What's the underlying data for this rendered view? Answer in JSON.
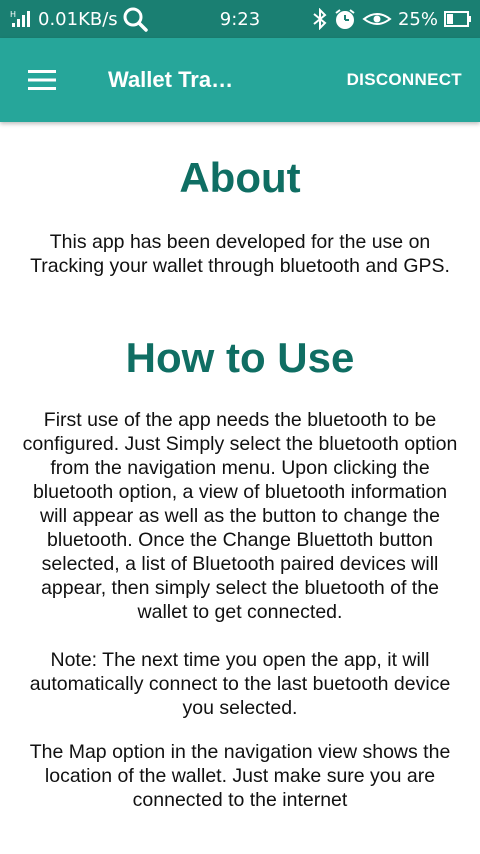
{
  "status_bar": {
    "network_speed": "0.01KB/s",
    "time": "9:23",
    "battery": "25%",
    "icons": [
      "signal-icon",
      "search-icon",
      "bluetooth-icon",
      "alarm-icon",
      "eye-icon",
      "battery-icon"
    ]
  },
  "app_bar": {
    "menu_icon": "hamburger-menu-icon",
    "title": "Wallet Tra…",
    "action": "DISCONNECT"
  },
  "about": {
    "title": "About",
    "text": "This app has been developed for the use on Tracking your wallet through bluetooth and GPS."
  },
  "how_to_use": {
    "title": "How to Use",
    "text": "First use of the app needs the bluetooth to be configured. Just Simply select the bluetooth option from the navigation menu. Upon clicking the bluetooth option, a view of bluetooth information will appear as well as the button to change the bluetooth. Once the Change Bluettoth button selected, a list of Bluetooth paired devices will appear, then simply select the bluetooth of the wallet to get connected.",
    "note": "Note: The next time you open the app, it will automatically connect to the last buetooth device you selected.",
    "map": "The Map option in the navigation view shows the location of the wallet. Just make sure you are connected to the internet"
  },
  "colors": {
    "status_bar": "#1a7f72",
    "app_bar": "#26a69a",
    "heading": "#0f6e63"
  }
}
